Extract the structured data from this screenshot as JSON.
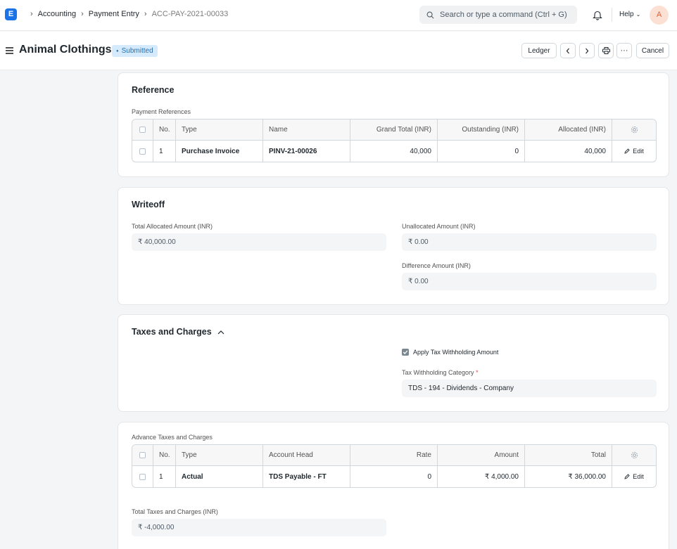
{
  "navbar": {
    "logo": "E",
    "breadcrumbs": [
      "Accounting",
      "Payment Entry",
      "ACC-PAY-2021-00033"
    ],
    "search_placeholder": "Search or type a command (Ctrl + G)",
    "help_label": "Help",
    "avatar_initial": "A"
  },
  "header": {
    "title": "Animal Clothings",
    "status": "Submitted",
    "ledger_label": "Ledger",
    "cancel_label": "Cancel"
  },
  "reference": {
    "title": "Reference",
    "table_label": "Payment References",
    "columns": [
      "No.",
      "Type",
      "Name",
      "Grand Total (INR)",
      "Outstanding (INR)",
      "Allocated (INR)"
    ],
    "rows": [
      {
        "no": "1",
        "type": "Purchase Invoice",
        "name": "PINV-21-00026",
        "grand_total": "40,000",
        "outstanding": "0",
        "allocated": "40,000",
        "edit": "Edit"
      }
    ]
  },
  "writeoff": {
    "title": "Writeoff",
    "total_allocated_label": "Total Allocated Amount (INR)",
    "total_allocated_value": "₹ 40,000.00",
    "unallocated_label": "Unallocated Amount (INR)",
    "unallocated_value": "₹ 0.00",
    "difference_label": "Difference Amount (INR)",
    "difference_value": "₹ 0.00"
  },
  "taxes": {
    "title": "Taxes and Charges",
    "apply_tds_label": "Apply Tax Withholding Amount",
    "apply_tds_checked": true,
    "category_label": "Tax Withholding Category",
    "category_required": "*",
    "category_value": "TDS - 194 - Dividends - Company"
  },
  "advance_taxes": {
    "table_label": "Advance Taxes and Charges",
    "columns": [
      "No.",
      "Type",
      "Account Head",
      "Rate",
      "Amount",
      "Total"
    ],
    "rows": [
      {
        "no": "1",
        "type": "Actual",
        "account_head": "TDS Payable - FT",
        "rate": "0",
        "amount": "₹ 4,000.00",
        "total": "₹ 36,000.00",
        "edit": "Edit"
      }
    ],
    "total_label": "Total Taxes and Charges (INR)",
    "total_value": "₹ -4,000.00"
  }
}
